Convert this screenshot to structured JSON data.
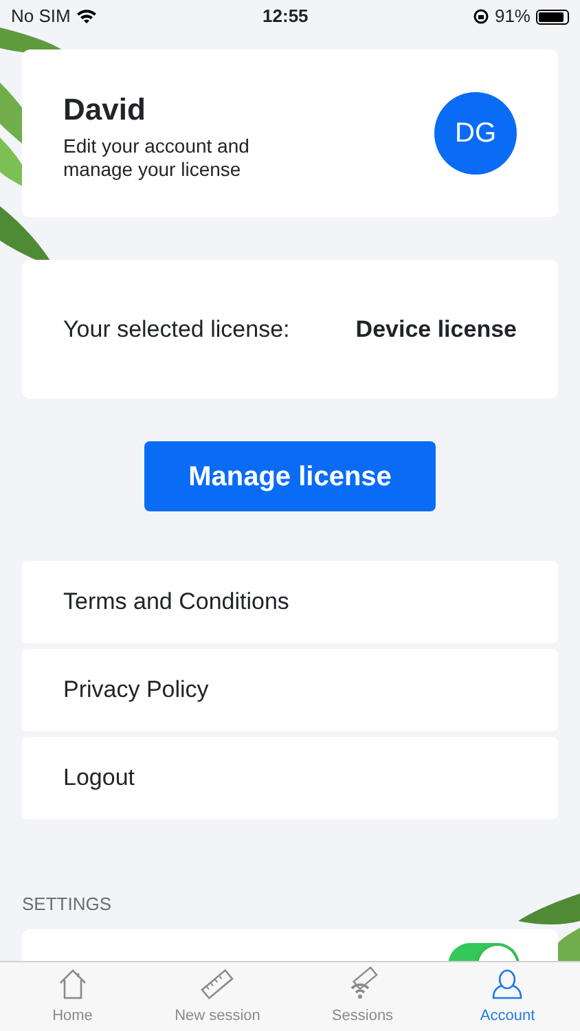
{
  "status_bar": {
    "carrier": "No SIM",
    "time": "12:55",
    "battery": "91%"
  },
  "profile": {
    "name": "David",
    "subtitle": "Edit your account and manage your license",
    "initials": "DG"
  },
  "license": {
    "label": "Your selected license:",
    "value": "Device license"
  },
  "manage_button": "Manage license",
  "links": [
    {
      "label": "Terms and Conditions"
    },
    {
      "label": "Privacy Policy"
    },
    {
      "label": "Logout"
    }
  ],
  "settings": {
    "heading": "SETTINGS",
    "items": [
      {
        "kind": "toggle",
        "on": true
      }
    ]
  },
  "tabs": [
    {
      "label": "Home",
      "kind": "home",
      "selected": false
    },
    {
      "label": "New session",
      "kind": "new",
      "selected": false
    },
    {
      "label": "Sessions",
      "kind": "sessions",
      "selected": false
    },
    {
      "label": "Account",
      "kind": "account",
      "selected": true
    }
  ]
}
